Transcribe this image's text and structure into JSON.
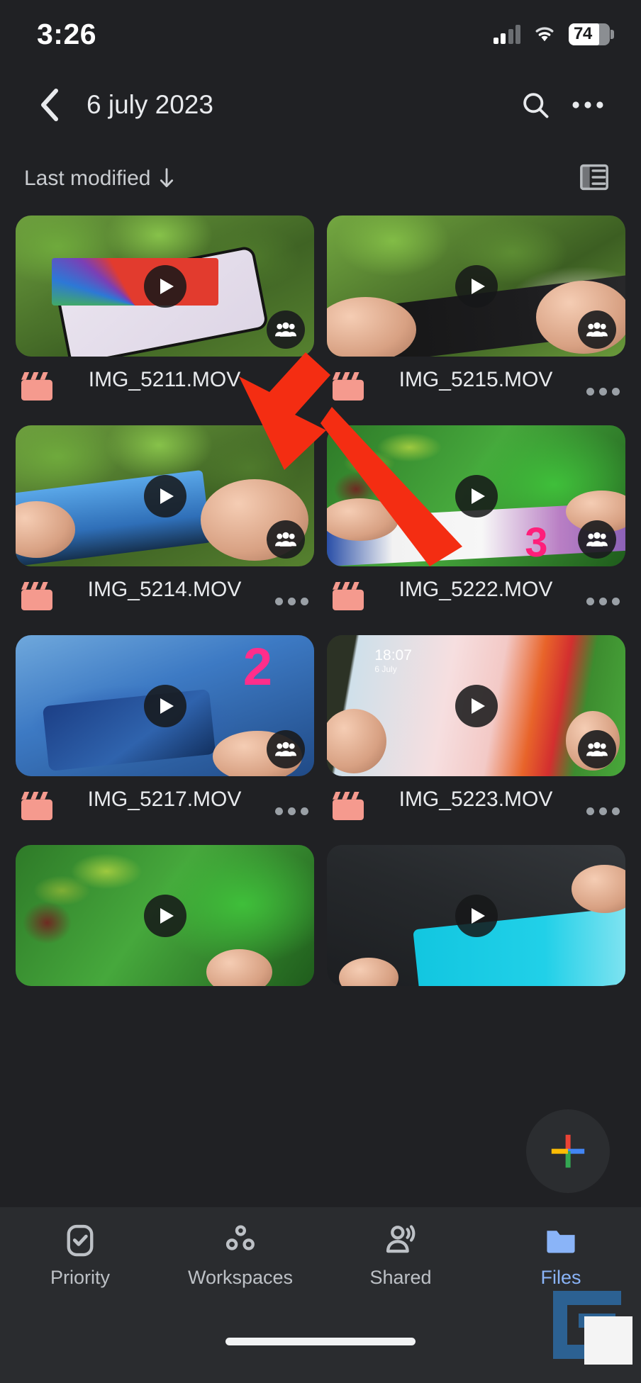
{
  "status_bar": {
    "time": "3:26",
    "battery_percent": "74",
    "signal_icon": "cellular-signal-icon",
    "wifi_icon": "wifi-icon",
    "battery_icon": "battery-icon",
    "signal_bars_active": 2,
    "signal_bars_total": 4
  },
  "app_bar": {
    "back_icon": "back-chevron-icon",
    "title": "6 july 2023",
    "search_icon": "search-icon",
    "overflow_icon": "more-options-icon"
  },
  "sort_row": {
    "sort_label": "Last modified",
    "sort_direction_icon": "arrow-down-icon",
    "view_toggle_icon": "list-view-icon"
  },
  "files": [
    {
      "name": "IMG_5211.MOV",
      "type_icon": "movie-clapperboard-icon",
      "play_icon": "play-icon",
      "shared_icon": "shared-people-icon",
      "overflow_icon": "more-options-icon",
      "art": "art-foliage",
      "variant": "phone-rainbow"
    },
    {
      "name": "IMG_5215.MOV",
      "type_icon": "movie-clapperboard-icon",
      "play_icon": "play-icon",
      "shared_icon": "shared-people-icon",
      "overflow_icon": "more-options-icon",
      "art": "art-foliage2",
      "variant": "phone-dark-bar"
    },
    {
      "name": "IMG_5214.MOV",
      "type_icon": "movie-clapperboard-icon",
      "play_icon": "play-icon",
      "shared_icon": "shared-people-icon",
      "overflow_icon": "more-options-icon",
      "art": "art-foliage",
      "variant": "phone-skyline"
    },
    {
      "name": "IMG_5222.MOV",
      "type_icon": "movie-clapperboard-icon",
      "play_icon": "play-icon",
      "shared_icon": "shared-people-icon",
      "overflow_icon": "more-options-icon",
      "art": "art-green",
      "variant": "bonsai-strip"
    },
    {
      "name": "IMG_5217.MOV",
      "type_icon": "movie-clapperboard-icon",
      "play_icon": "play-icon",
      "shared_icon": "shared-people-icon",
      "overflow_icon": "more-options-icon",
      "art": "art-racing",
      "variant": "racing",
      "overlay_text": "2"
    },
    {
      "name": "IMG_5223.MOV",
      "type_icon": "movie-clapperboard-icon",
      "play_icon": "play-icon",
      "shared_icon": "shared-people-icon",
      "overflow_icon": "more-options-icon",
      "art": "art-lock",
      "variant": "lockscreen",
      "lock_time": "18:07",
      "lock_date": "6 July"
    },
    {
      "name": "",
      "type_icon": "movie-clapperboard-icon",
      "play_icon": "play-icon",
      "shared_icon": "",
      "overflow_icon": "",
      "art": "art-green",
      "variant": "bonsai-partial"
    },
    {
      "name": "",
      "type_icon": "movie-clapperboard-icon",
      "play_icon": "play-icon",
      "shared_icon": "",
      "overflow_icon": "",
      "art": "art-dark",
      "variant": "cyan-partial"
    }
  ],
  "fab": {
    "icon": "google-plus-add-icon",
    "colors": [
      "#ea4335",
      "#4285f4",
      "#34a853",
      "#fbbc05"
    ]
  },
  "bottom_nav": {
    "items": [
      {
        "label": "Priority",
        "icon": "priority-check-icon",
        "active": false
      },
      {
        "label": "Workspaces",
        "icon": "workspaces-dots-icon",
        "active": false
      },
      {
        "label": "Shared",
        "icon": "shared-people-icon",
        "active": false
      },
      {
        "label": "Files",
        "icon": "folder-icon",
        "active": true
      }
    ],
    "active_color": "#8ab4f8",
    "inactive_color": "#bdc1c6"
  },
  "annotation": {
    "arrow_icon": "red-arrow-annotation",
    "color": "#f42d12",
    "points_to": "overflow-menu of IMG_5211.MOV"
  },
  "home_indicator": {
    "icon": "home-indicator-bar"
  },
  "watermark": {
    "icon": "gadgets-to-use-watermark-logo",
    "color": "#2d6498"
  },
  "theme": {
    "background": "#202124",
    "surface": "#2a2c2f",
    "text_primary": "#e8eaed",
    "text_secondary": "#bdc1c6",
    "clapper_color": "#f59a8e"
  }
}
